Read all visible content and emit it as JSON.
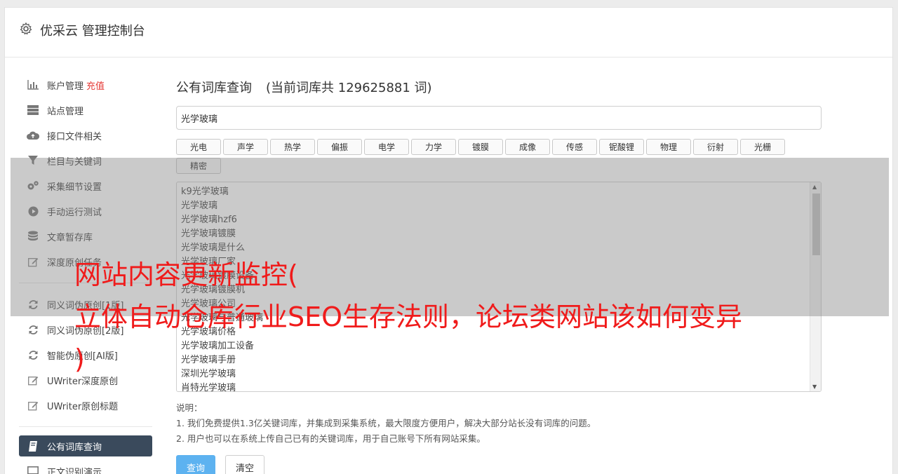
{
  "header": {
    "title": "优采云 管理控制台"
  },
  "sidebar": {
    "items": [
      {
        "label": "账户管理",
        "extra": "充值",
        "icon": "bar-chart-icon"
      },
      {
        "label": "站点管理",
        "icon": "server-icon"
      },
      {
        "label": "接口文件相关",
        "icon": "cloud-upload-icon"
      },
      {
        "label": "栏目与关键词",
        "icon": "filter-icon"
      },
      {
        "label": "采集细节设置",
        "icon": "gears-icon"
      },
      {
        "label": "手动运行测试",
        "icon": "play-circle-icon"
      },
      {
        "label": "文章暂存库",
        "icon": "database-icon"
      },
      {
        "label": "深度原创任务",
        "icon": "edit-icon"
      },
      {
        "label": "同义词伪原创[1版]",
        "icon": "refresh-icon"
      },
      {
        "label": "同义词伪原创[2版]",
        "icon": "refresh-icon"
      },
      {
        "label": "智能伪原创[AI版]",
        "icon": "refresh-icon"
      },
      {
        "label": "UWriter深度原创",
        "icon": "edit-icon"
      },
      {
        "label": "UWriter原创标题",
        "icon": "edit-icon"
      },
      {
        "label": "公有词库查询",
        "icon": "book-icon"
      },
      {
        "label": "正文识别演示",
        "icon": "monitor-icon"
      }
    ]
  },
  "main": {
    "title": "公有词库查询",
    "count_text": "(当前词库共 129625881 词)",
    "search_value": "光学玻璃",
    "tags": [
      "光电",
      "声学",
      "热学",
      "偏振",
      "电学",
      "力学",
      "镀膜",
      "成像",
      "传感",
      "铌酸锂",
      "物理",
      "衍射",
      "光栅",
      "精密"
    ],
    "results": [
      "k9光学玻璃",
      "光学玻璃",
      "光学玻璃hzf6",
      "光学玻璃镀膜",
      "光学玻璃是什么",
      "光学玻璃厂家",
      "光学玻璃镀膜设备",
      "光学玻璃镀膜机",
      "光学玻璃公司",
      "光学玻璃与普通玻璃",
      "光学玻璃价格",
      "光学玻璃加工设备",
      "光学玻璃手册",
      "深圳光学玻璃",
      "肖特光学玻璃"
    ],
    "notes_title": "说明：",
    "notes": [
      "1. 我们免费提供1.3亿关键词库，并集成到采集系统，最大限度方便用户，解决大部分站长没有词库的问题。",
      "2. 用户也可以在系统上传自己已有的关键词库，用于自己账号下所有网站采集。"
    ],
    "query_button": "查询",
    "clear_button": "清空"
  },
  "overlay": {
    "line1": "网站内容更新监控(",
    "line2": "立体自动仓库行业SEO生存法则，论坛类网站该如何变异",
    "line3": ")"
  }
}
